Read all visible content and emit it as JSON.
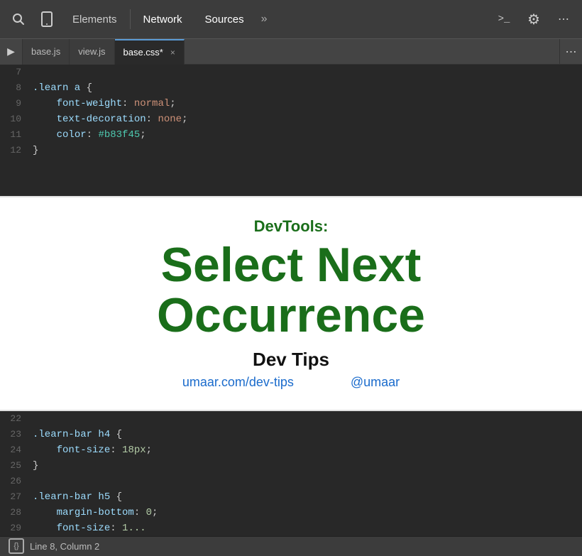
{
  "toolbar": {
    "tabs": [
      {
        "id": "elements",
        "label": "Elements",
        "active": false
      },
      {
        "id": "network",
        "label": "Network",
        "active": false
      },
      {
        "id": "sources",
        "label": "Sources",
        "active": true
      }
    ],
    "more_label": "»",
    "terminal_icon": ">_",
    "settings_icon": "⚙",
    "more_right_icon": "⋯"
  },
  "file_tabs": {
    "sidebar_icon": "▶",
    "tabs": [
      {
        "id": "basejs",
        "label": "base.js",
        "active": false,
        "closeable": false
      },
      {
        "id": "viewjs",
        "label": "view.js",
        "active": false,
        "closeable": false
      },
      {
        "id": "basecss",
        "label": "base.css*",
        "active": true,
        "closeable": true
      }
    ],
    "right_icon": "⋯"
  },
  "code_top": {
    "lines": [
      {
        "num": "7",
        "content": ""
      },
      {
        "num": "8",
        "content": ".learn a {"
      },
      {
        "num": "9",
        "content": "    font-weight: normal;"
      },
      {
        "num": "10",
        "content": "    text-decoration: none;"
      },
      {
        "num": "11",
        "content": "    color: #b83f45;"
      },
      {
        "num": "12",
        "content": "}"
      }
    ]
  },
  "overlay": {
    "subtitle": "DevTools:",
    "title": "Select Next Occurrence",
    "devtips_label": "Dev Tips",
    "link1_text": "umaar.com/dev-tips",
    "link1_url": "#",
    "link2_text": "@umaar",
    "link2_url": "#"
  },
  "code_bottom": {
    "lines": [
      {
        "num": "22",
        "content": ""
      },
      {
        "num": "23",
        "content": ".learn-bar h4 {"
      },
      {
        "num": "24",
        "content": "    font-size: 18px;"
      },
      {
        "num": "25",
        "content": "}"
      },
      {
        "num": "26",
        "content": ""
      },
      {
        "num": "27",
        "content": ".learn-bar h5 {"
      },
      {
        "num": "28",
        "content": "    margin-bottom: 0;"
      },
      {
        "num": "29",
        "content": "    font-size: 1..."
      }
    ]
  },
  "status_bar": {
    "icon": "{}",
    "text": "Line 8, Column 2"
  }
}
